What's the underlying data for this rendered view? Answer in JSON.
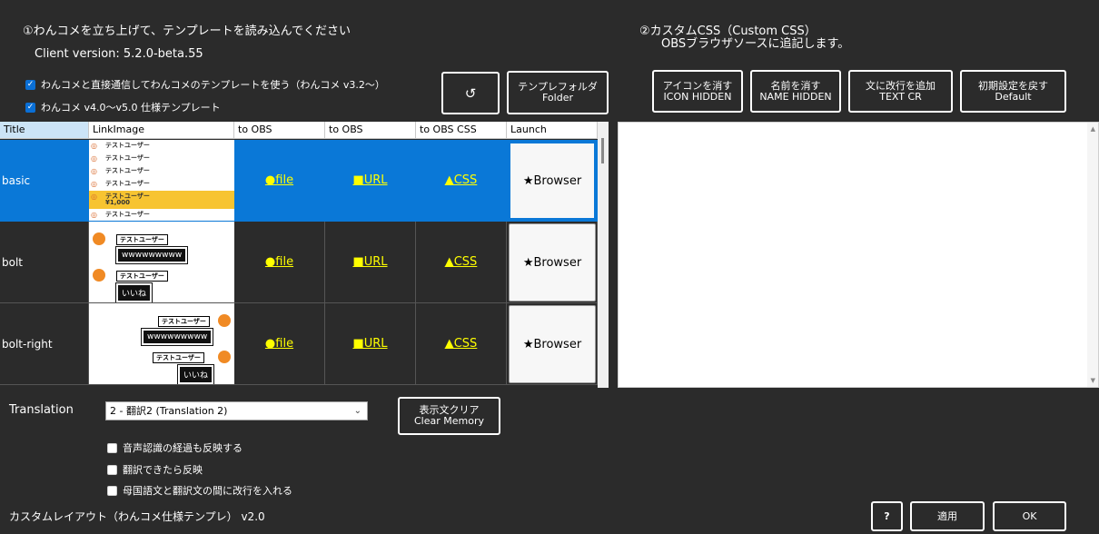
{
  "header": {
    "step1": "①わんコメを立ち上げて、テンプレートを読み込んでください",
    "client_version": "Client version: 5.2.0-beta.55",
    "step2_line1": "②カスタムCSS（Custom CSS）",
    "step2_line2": "OBSブラウザソースに追記します。"
  },
  "options": {
    "direct_connect": "わんコメと直接通信してわんコメのテンプレートを使う（わんコメ v3.2〜）",
    "v4_template": "わんコメ v4.0〜v5.0 仕様テンプレート"
  },
  "buttons": {
    "refresh": "↺",
    "template_folder_1": "テンプレフォルダ",
    "template_folder_2": "Folder",
    "icon_hidden_1": "アイコンを消す",
    "icon_hidden_2": "ICON HIDDEN",
    "name_hidden_1": "名前を消す",
    "name_hidden_2": "NAME HIDDEN",
    "text_cr_1": "文に改行を追加",
    "text_cr_2": "TEXT CR",
    "default_1": "初期設定を戻す",
    "default_2": "Default",
    "clear_memory_1": "表示文クリア",
    "clear_memory_2": "Clear Memory",
    "help": "?",
    "apply": "適用",
    "ok": "OK"
  },
  "table": {
    "headers": [
      "Title",
      "LinkImage",
      "to OBS",
      "to OBS",
      "to OBS CSS",
      "Launch"
    ],
    "rows": [
      {
        "title": "basic",
        "file": "●file",
        "url": "■URL",
        "css": "▲CSS",
        "launch": "★Browser"
      },
      {
        "title": "bolt",
        "file": "●file",
        "url": "■URL",
        "css": "▲CSS",
        "launch": "★Browser"
      },
      {
        "title": "bolt-right",
        "file": "●file",
        "url": "■URL",
        "css": "▲CSS",
        "launch": "★Browser"
      }
    ],
    "thumb_texts": {
      "user": "テストユーザー",
      "amount": "¥1,000",
      "www": "wwwwwwwww",
      "iine": "いいね"
    }
  },
  "translation": {
    "label": "Translation",
    "selected": "2 - 翻訳2 (Translation 2)",
    "opt1": "音声認識の経過も反映する",
    "opt2": "翻訳できたら反映",
    "opt3": "母国語文と翻訳文の間に改行を入れる"
  },
  "footer": {
    "layout_name": "カスタムレイアウト（わんコメ仕様テンプレ） v2.0"
  },
  "colors": {
    "background": "#2b2b2b",
    "selected_row": "#0a78d7",
    "link": "#ffff00"
  }
}
